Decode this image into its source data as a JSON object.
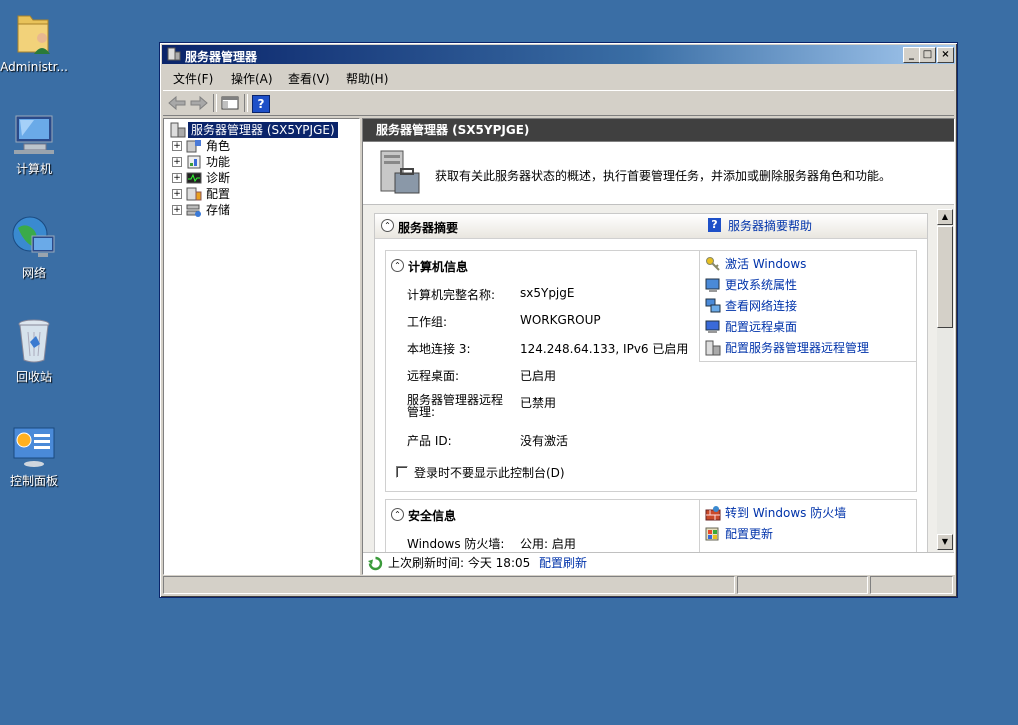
{
  "desktop": {
    "icons": [
      {
        "label": "Administr..."
      },
      {
        "label": "计算机"
      },
      {
        "label": "网络"
      },
      {
        "label": "回收站"
      },
      {
        "label": "控制面板"
      }
    ]
  },
  "window": {
    "title": "服务器管理器",
    "controls": {
      "minimize": "_",
      "maximize": "□",
      "close": "×"
    }
  },
  "menu": [
    "文件(F)",
    "操作(A)",
    "查看(V)",
    "帮助(H)"
  ],
  "toolbar": {
    "help_label": "?"
  },
  "tree": {
    "root": "服务器管理器 (SX5YPJGE)",
    "expand_glyph": "+",
    "items": [
      {
        "label": "角色",
        "icon": "roles-icon"
      },
      {
        "label": "功能",
        "icon": "features-icon"
      },
      {
        "label": "诊断",
        "icon": "diagnostics-icon"
      },
      {
        "label": "配置",
        "icon": "configuration-icon"
      },
      {
        "label": "存储",
        "icon": "storage-icon"
      }
    ]
  },
  "main": {
    "header": "服务器管理器 (SX5YPJGE)",
    "intro": "获取有关此服务器状态的概述，执行首要管理任务，并添加或删除服务器角色和功能。",
    "collapse_glyph": "⌃",
    "summary": {
      "title": "服务器摘要",
      "help_link": "服务器摘要帮助",
      "computer_info": {
        "title": "计算机信息",
        "props": [
          {
            "key": "计算机完整名称:",
            "value": "sx5YpjgE"
          },
          {
            "key": "工作组:",
            "value": "WORKGROUP"
          },
          {
            "key": "本地连接 3:",
            "value": "124.248.64.133, IPv6 已启用"
          },
          {
            "key": "远程桌面:",
            "value": "已启用"
          },
          {
            "key": "服务器管理器远程管理:",
            "value": "已禁用"
          },
          {
            "key": "产品 ID:",
            "value": "没有激活"
          }
        ],
        "checkbox_label": "登录时不要显示此控制台(D)",
        "links": [
          "激活 Windows",
          "更改系统属性",
          "查看网络连接",
          "配置远程桌面",
          "配置服务器管理器远程管理"
        ]
      },
      "security_info": {
        "title": "安全信息",
        "props": [
          {
            "key": "Windows 防火墙:",
            "value": "公用: 启用"
          }
        ],
        "links": [
          "转到 Windows 防火墙",
          "配置更新"
        ]
      }
    },
    "footer": {
      "last_refresh": "上次刷新时间: 今天 18:05",
      "refresh_link": "配置刷新"
    }
  },
  "colors": {
    "desktop": "#3a6ea5",
    "title_active": "#0a246a",
    "link": "#0033aa",
    "header": "#404040"
  }
}
